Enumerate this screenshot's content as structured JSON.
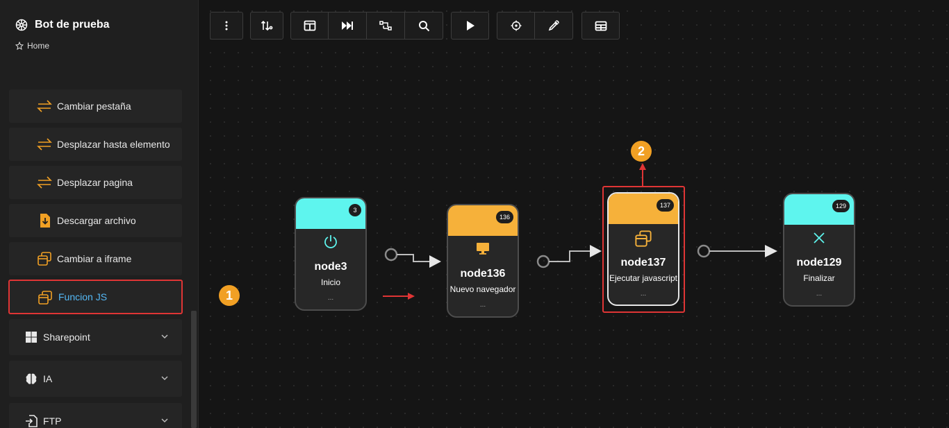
{
  "app": {
    "title": "Bot de prueba",
    "home_label": "Home"
  },
  "sidebar": {
    "items": [
      {
        "label": "Cambiar pestaña",
        "icon": "swap-arrows-icon"
      },
      {
        "label": "Desplazar hasta elemento",
        "icon": "swap-arrows-icon"
      },
      {
        "label": "Desplazar pagina",
        "icon": "swap-arrows-icon"
      },
      {
        "label": "Descargar archivo",
        "icon": "file-download-icon"
      },
      {
        "label": "Cambiar a iframe",
        "icon": "iframe-icon"
      },
      {
        "label": "Funcion JS",
        "icon": "iframe-icon"
      }
    ],
    "groups": [
      {
        "label": "Sharepoint",
        "icon": "windows-icon"
      },
      {
        "label": "IA",
        "icon": "brain-icon"
      },
      {
        "label": "FTP",
        "icon": "file-import-icon"
      }
    ]
  },
  "toolbar": {
    "groups": [
      [
        "more-vertical-icon"
      ],
      [
        "sort-icon"
      ],
      [
        "panel-layout-icon",
        "skip-forward-icon",
        "route-icon",
        "search-icon"
      ],
      [
        "play-icon"
      ],
      [
        "target-icon",
        "pipette-icon"
      ],
      [
        "table-icon"
      ]
    ]
  },
  "nodes": [
    {
      "id": "3",
      "name": "node3",
      "subtitle": "Inicio",
      "dots": "...",
      "header_color": "#5ef5ee",
      "icon": "power-icon"
    },
    {
      "id": "136",
      "name": "node136",
      "subtitle": "Nuevo navegador",
      "dots": "...",
      "header_color": "#f6b13a",
      "icon": "monitor-icon"
    },
    {
      "id": "137",
      "name": "node137",
      "subtitle": "Ejecutar javascript",
      "dots": "...",
      "header_color": "#f6b13a",
      "icon": "iframe-icon"
    },
    {
      "id": "129",
      "name": "node129",
      "subtitle": "Finalizar",
      "dots": "...",
      "header_color": "#5ef5ee",
      "icon": "x-icon"
    }
  ],
  "annotations": {
    "callout_1": "1",
    "callout_2": "2"
  },
  "colors": {
    "accent_orange": "#f1a024",
    "highlight_red": "#e03535",
    "teal": "#5ef5ee",
    "link_blue": "#54b8f5"
  }
}
